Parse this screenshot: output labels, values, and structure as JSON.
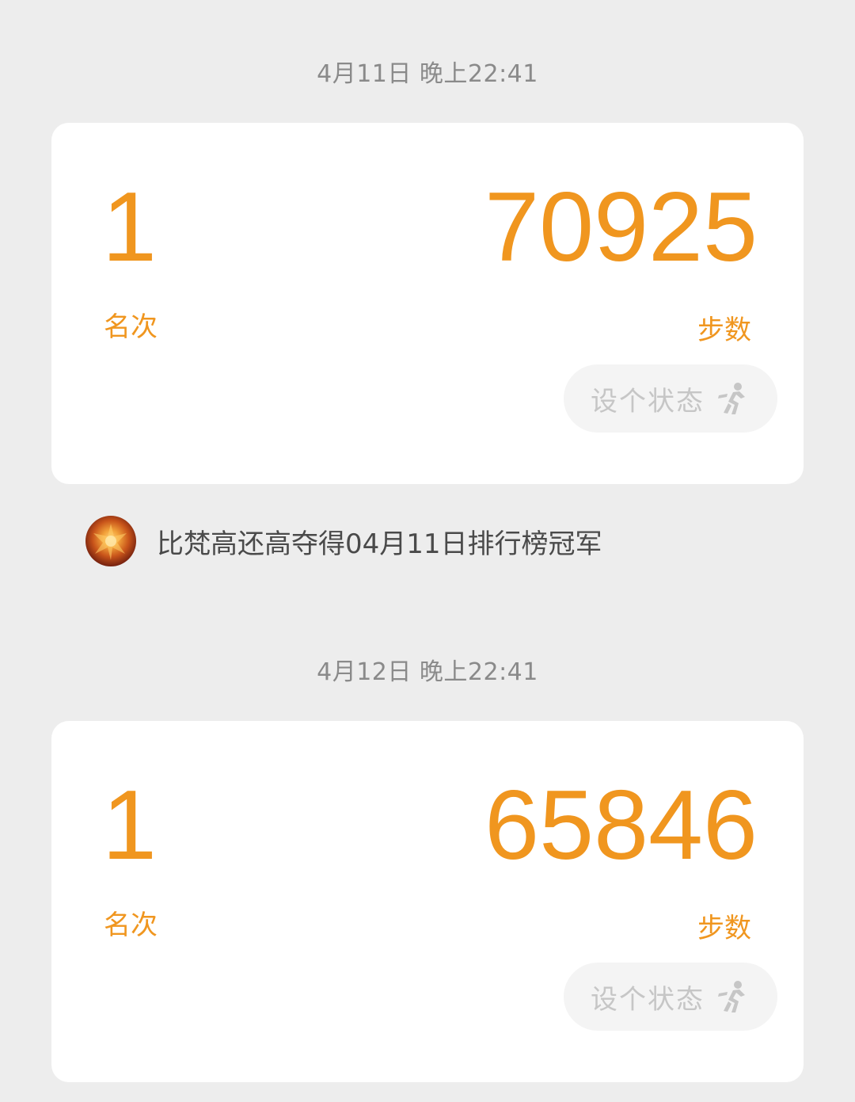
{
  "entries": [
    {
      "timestamp": "4月11日 晚上22:41",
      "rank_value": "1",
      "rank_label": "名次",
      "steps_value": "70925",
      "steps_label": "步数",
      "status_button_label": "设个状态",
      "status_icon": "running-person-icon"
    },
    {
      "timestamp": "4月12日 晚上22:41",
      "rank_value": "1",
      "rank_label": "名次",
      "steps_value": "65846",
      "steps_label": "步数",
      "status_button_label": "设个状态",
      "status_icon": "running-person-icon"
    }
  ],
  "champion_notice": {
    "text": "比梵高还高夺得04月11日排行榜冠军",
    "avatar_icon": "user-avatar"
  },
  "colors": {
    "background": "#ededed",
    "card": "#ffffff",
    "accent_orange": "#f0961f",
    "timestamp_gray": "#8a8a8a",
    "status_button_bg": "#f4f4f4",
    "status_text": "#c6c6c6"
  }
}
